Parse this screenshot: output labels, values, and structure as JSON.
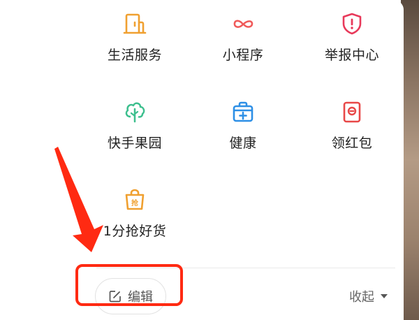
{
  "grid": [
    {
      "label": "生活服务",
      "icon": "life-service-icon"
    },
    {
      "label": "小程序",
      "icon": "mini-program-icon"
    },
    {
      "label": "举报中心",
      "icon": "report-center-icon"
    },
    {
      "label": "快手果园",
      "icon": "orchard-tree-icon"
    },
    {
      "label": "健康",
      "icon": "health-kit-icon"
    },
    {
      "label": "领红包",
      "icon": "red-packet-icon"
    },
    {
      "label": "1分抢好货",
      "icon": "grab-goods-bag-icon"
    }
  ],
  "footer": {
    "edit_label": "编辑",
    "collapse_label": "收起"
  },
  "annotation_color": "#ff2a12"
}
